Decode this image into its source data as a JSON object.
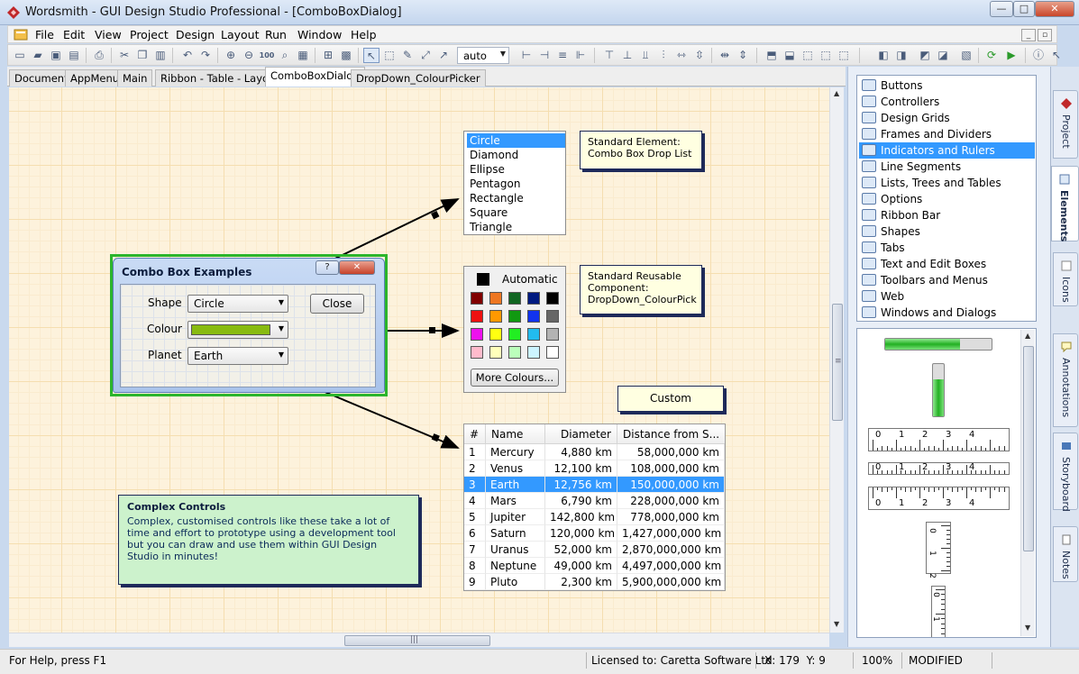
{
  "window": {
    "title": "Wordsmith - GUI Design Studio Professional - [ComboBoxDialog]",
    "controls": {
      "minimize": "—",
      "maximize": "□",
      "close": "✕"
    }
  },
  "menubar": {
    "items": [
      "File",
      "Edit",
      "View",
      "Project",
      "Design",
      "Layout",
      "Run",
      "Window",
      "Help"
    ],
    "mdi_controls": [
      "_",
      "▫",
      "✕"
    ]
  },
  "toolbar": {
    "zoom_value": "auto"
  },
  "doc_tabs": [
    "Document",
    "AppMenu",
    "Main",
    "Ribbon - Table - Layout",
    "ComboBoxDialog",
    "DropDown_ColourPicker"
  ],
  "doc_tabs_active": "ComboBoxDialog",
  "dialog": {
    "title": "Combo Box Examples",
    "help_btn": "?",
    "close_btn": "✕",
    "shape_label": "Shape",
    "shape_value": "Circle",
    "colour_label": "Colour",
    "colour_value": "#88bb11",
    "planet_label": "Planet",
    "planet_value": "Earth",
    "close_button": "Close"
  },
  "drop_list": {
    "items": [
      "Circle",
      "Diamond",
      "Ellipse",
      "Pentagon",
      "Rectangle",
      "Square",
      "Triangle"
    ],
    "selected": "Circle"
  },
  "notes": {
    "standard_element": [
      "Standard Element:",
      "Combo Box Drop List"
    ],
    "standard_reusable": [
      "Standard Reusable",
      "Component:",
      "DropDown_ColourPick"
    ],
    "custom": "Custom",
    "complex_title": "Complex Controls",
    "complex_body": "Complex, customised controls like these take a lot of time and effort to prototype using a development tool but you can draw and use them within GUI Design Studio in minutes!"
  },
  "colour_picker": {
    "automatic_label": "Automatic",
    "automatic_colour": "#000000",
    "swatches": [
      [
        "#800000",
        "#ee7722",
        "#116622",
        "#001a80",
        "#000000"
      ],
      [
        "#ee1111",
        "#ff9900",
        "#119911",
        "#1133ee",
        "#666666"
      ],
      [
        "#ee11ee",
        "#ffff11",
        "#22ee22",
        "#22bbee",
        "#b3b3b3"
      ],
      [
        "#ffbbcc",
        "#ffffbb",
        "#bbffbb",
        "#ccf4ff",
        "#ffffff"
      ]
    ],
    "more_button": "More Colours..."
  },
  "planet_table": {
    "columns": [
      "#",
      "Name",
      "Diameter",
      "Distance from S..."
    ],
    "rows": [
      [
        "1",
        "Mercury",
        "4,880 km",
        "58,000,000 km"
      ],
      [
        "2",
        "Venus",
        "12,100 km",
        "108,000,000 km"
      ],
      [
        "3",
        "Earth",
        "12,756 km",
        "150,000,000 km"
      ],
      [
        "4",
        "Mars",
        "6,790 km",
        "228,000,000 km"
      ],
      [
        "5",
        "Jupiter",
        "142,800 km",
        "778,000,000 km"
      ],
      [
        "6",
        "Saturn",
        "120,000 km",
        "1,427,000,000 km"
      ],
      [
        "7",
        "Uranus",
        "52,000 km",
        "2,870,000,000 km"
      ],
      [
        "8",
        "Neptune",
        "49,000 km",
        "4,497,000,000 km"
      ],
      [
        "9",
        "Pluto",
        "2,300 km",
        "5,900,000,000 km"
      ]
    ],
    "selected_row": 2
  },
  "elements": {
    "items": [
      "Buttons",
      "Controllers",
      "Design Grids",
      "Frames and Dividers",
      "Indicators and Rulers",
      "Line Segments",
      "Lists, Trees and Tables",
      "Options",
      "Ribbon Bar",
      "Shapes",
      "Tabs",
      "Text and Edit Boxes",
      "Toolbars and Menus",
      "Web",
      "Windows and Dialogs"
    ],
    "selected": "Indicators and Rulers"
  },
  "preview": {
    "progress_fraction": 0.7,
    "ruler_labels": [
      "0",
      "1",
      "2",
      "3",
      "4"
    ],
    "vruler_labels": [
      "0",
      "1",
      "2"
    ]
  },
  "side_tabs": [
    "Project",
    "Elements",
    "Icons",
    "Annotations",
    "Storyboard",
    "Notes"
  ],
  "side_tab_active": "Elements",
  "status": {
    "help": "For Help, press F1",
    "license": "Licensed to: Caretta Software Ltd",
    "coords": "X: 179  Y: 9",
    "zoom": "100%",
    "state": "MODIFIED"
  },
  "scroll": {
    "hgrip": "|||",
    "vgrip": "≡"
  },
  "colors": {
    "accent": "#3399ff",
    "frame_green": "#2cb52c",
    "note_bg": "#ffffe1",
    "complex_bg": "#ccf2cc"
  }
}
